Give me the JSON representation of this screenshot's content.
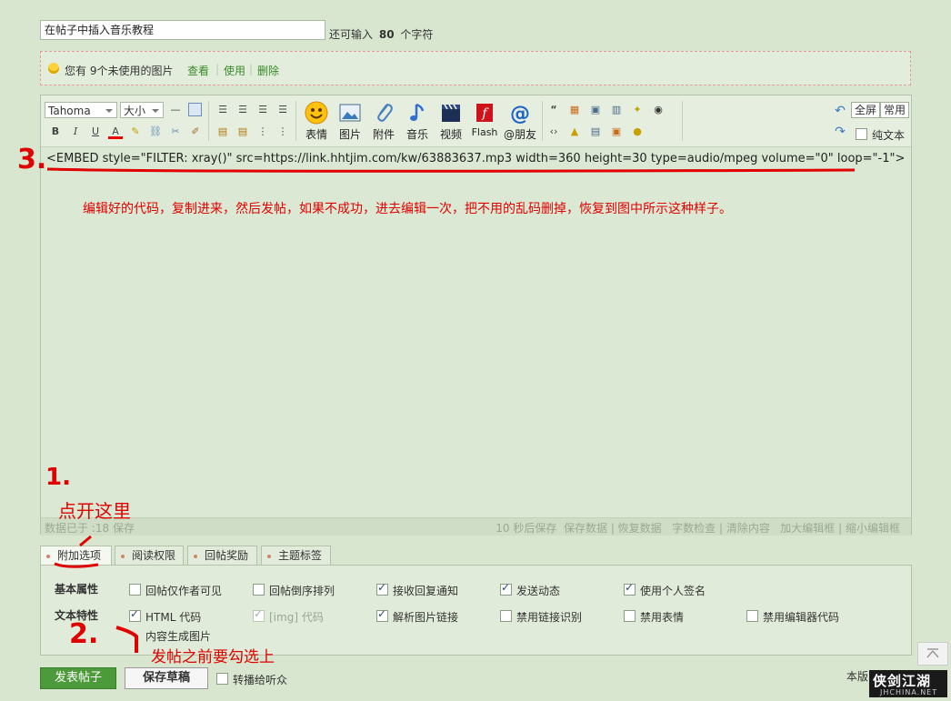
{
  "title_input": {
    "value": "在帖子中插入音乐教程"
  },
  "char_counter": {
    "prefix": "还可输入",
    "count": "80",
    "suffix": "个字符"
  },
  "notice": {
    "text": "您有 9个未使用的图片",
    "view": "查看",
    "use": "使用",
    "delete": "删除"
  },
  "toolbar": {
    "font_family": "Tahoma",
    "font_size": "大小",
    "bold": "B",
    "italic": "I",
    "underline": "U",
    "color": "A",
    "emoji": "表情",
    "image": "图片",
    "attachment": "附件",
    "music": "音乐",
    "video": "视频",
    "flash": "Flash",
    "mention": "@朋友",
    "fullscreen": "全屏",
    "common": "常用",
    "plain_text": "纯文本"
  },
  "editor": {
    "code": "<EMBED style=\"FILTER: xray()\" src=https://link.hhtjim.com/kw/63883637.mp3 width=360 height=30 type=audio/mpeg volume=\"0\" loop=\"-1\">",
    "note": "编辑好的代码，复制进来，然后发帖，如果不成功，进去编辑一次，把不用的乱码删掉，恢复到图中所示这种样子。"
  },
  "status_bar": {
    "saved": "数据已于    :18 保存",
    "autosave": "10 秒后保存",
    "save": "保存数据",
    "restore": "恢复数据",
    "check": "字数检查",
    "clear": "清除内容",
    "enlarge": "加大编辑框",
    "shrink": "缩小编辑框"
  },
  "tabs": [
    "附加选项",
    "阅读权限",
    "回帖奖励",
    "主题标签"
  ],
  "options": {
    "basic_heading": "基本属性",
    "text_heading": "文本特性",
    "basic": [
      {
        "label": "回帖仅作者可见",
        "checked": false
      },
      {
        "label": "回帖倒序排列",
        "checked": false
      },
      {
        "label": "接收回复通知",
        "checked": true
      },
      {
        "label": "发送动态",
        "checked": true
      },
      {
        "label": "使用个人签名",
        "checked": true
      }
    ],
    "text": [
      {
        "label": "HTML 代码",
        "checked": true
      },
      {
        "label": "[img] 代码",
        "checked": true
      },
      {
        "label": "解析图片链接",
        "checked": true
      },
      {
        "label": "禁用链接识别",
        "checked": false
      },
      {
        "label": "禁用表情",
        "checked": false
      },
      {
        "label": "禁用编辑器代码",
        "checked": false
      }
    ],
    "extra": "内容生成图片"
  },
  "buttons": {
    "submit": "发表帖子",
    "draft": "保存草稿",
    "repost": "转播给听众"
  },
  "footer_partial": "本版",
  "annotations": {
    "step1_number": "1.",
    "step1_text": "点开这里",
    "step2_number": "2.",
    "step2_text": "发帖之前要勾选上",
    "step3_number": "3."
  },
  "watermark": {
    "line1": "侠剑江湖",
    "line2": "JHCHINA.NET"
  },
  "colors": {
    "accent_green": "#4d9a3b",
    "annotation_red": "#e00000",
    "bg": "#d8e6cf"
  }
}
